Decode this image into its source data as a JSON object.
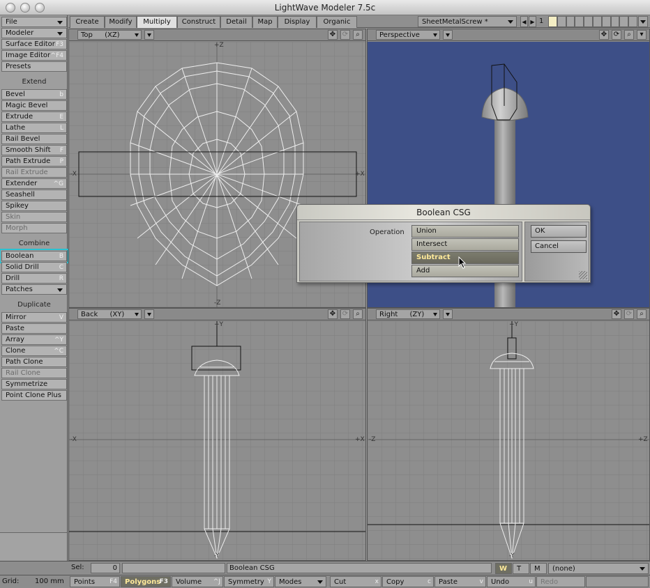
{
  "window": {
    "title": "LightWave Modeler 7.5c"
  },
  "tabs": [
    "Create",
    "Modify",
    "Multiply",
    "Construct",
    "Detail",
    "Map",
    "Display",
    "Organic"
  ],
  "active_tab": "Multiply",
  "object_select": {
    "value": "SheetMetalScrew *",
    "layer_number": "1"
  },
  "sidebar": {
    "top_menus": [
      "File",
      "Modeler"
    ],
    "top_items": [
      {
        "label": "Surface Editor",
        "shortcut": "F3"
      },
      {
        "label": "Image Editor",
        "shortcut": "^F4"
      },
      {
        "label": "Presets",
        "shortcut": ""
      }
    ],
    "sections": {
      "extend": "Extend",
      "combine": "Combine",
      "duplicate": "Duplicate"
    },
    "extend_items": [
      {
        "label": "Bevel",
        "shortcut": "b"
      },
      {
        "label": "Magic Bevel",
        "shortcut": ""
      },
      {
        "label": "Extrude",
        "shortcut": "E"
      },
      {
        "label": "Lathe",
        "shortcut": "L"
      },
      {
        "label": "Rail Bevel",
        "shortcut": ""
      },
      {
        "label": "Smooth Shift",
        "shortcut": "F"
      },
      {
        "label": "Path Extrude",
        "shortcut": "P"
      },
      {
        "label": "Rail Extrude",
        "shortcut": ""
      },
      {
        "label": "Extender",
        "shortcut": "^G"
      },
      {
        "label": "Seashell",
        "shortcut": ""
      },
      {
        "label": "Spikey",
        "shortcut": ""
      },
      {
        "label": "Skin",
        "shortcut": ""
      },
      {
        "label": "Morph",
        "shortcut": ""
      }
    ],
    "combine_items": [
      {
        "label": "Boolean",
        "shortcut": "B"
      },
      {
        "label": "Solid Drill",
        "shortcut": "C"
      },
      {
        "label": "Drill",
        "shortcut": "R"
      },
      {
        "label": "Patches",
        "shortcut": ""
      }
    ],
    "duplicate_items": [
      {
        "label": "Mirror",
        "shortcut": "V"
      },
      {
        "label": "Paste",
        "shortcut": ""
      },
      {
        "label": "Array",
        "shortcut": "^Y"
      },
      {
        "label": "Clone",
        "shortcut": "^C"
      },
      {
        "label": "Path Clone",
        "shortcut": ""
      },
      {
        "label": "Rail Clone",
        "shortcut": ""
      },
      {
        "label": "Symmetrize",
        "shortcut": ""
      },
      {
        "label": "Point Clone Plus",
        "shortcut": ""
      }
    ]
  },
  "viewports": {
    "top_left": {
      "view": "Top",
      "axes": "(XZ)",
      "plus_z": "+Z",
      "minus_z": "-Z",
      "plus_x": "+X",
      "minus_x": "-X"
    },
    "top_right": {
      "view": "Perspective"
    },
    "bottom_left": {
      "view": "Back",
      "axes": "(XY)",
      "plus_y": "+Y",
      "minus_y": "-Y",
      "plus_x": "+X",
      "minus_x": "-X"
    },
    "bottom_right": {
      "view": "Right",
      "axes": "(ZY)",
      "plus_y": "+Y",
      "minus_y": "-Y",
      "plus_z": "+Z",
      "minus_z": "-Z"
    }
  },
  "dialog": {
    "title": "Boolean CSG",
    "operation_label": "Operation",
    "options": [
      "Union",
      "Intersect",
      "Subtract",
      "Add"
    ],
    "selected": "Subtract",
    "ok": "OK",
    "cancel": "Cancel"
  },
  "status": {
    "sel_label": "Sel:",
    "sel_value": "0",
    "message": "Boolean CSG",
    "wtm": [
      "W",
      "T",
      "M"
    ],
    "active_wtm": "W",
    "surface": "(none)"
  },
  "bottom": {
    "grid_label": "Grid:",
    "grid_value": "100 mm",
    "modes": [
      {
        "label": "Points",
        "shortcut": "F4"
      },
      {
        "label": "Polygons",
        "shortcut": "F3"
      },
      {
        "label": "Volume",
        "shortcut": "^J"
      }
    ],
    "active_mode": "Polygons",
    "symmetry": {
      "label": "Symmetry",
      "shortcut": "Y"
    },
    "modes_menu": "Modes",
    "actions": [
      {
        "label": "Cut",
        "shortcut": "x"
      },
      {
        "label": "Copy",
        "shortcut": "c"
      },
      {
        "label": "Paste",
        "shortcut": "v"
      },
      {
        "label": "Undo",
        "shortcut": "u"
      },
      {
        "label": "Redo",
        "shortcut": ""
      }
    ]
  },
  "colors": {
    "perspective_bg": "#3d4f87",
    "highlight": "#29c1d1",
    "selected_text": "#ffea9a"
  }
}
